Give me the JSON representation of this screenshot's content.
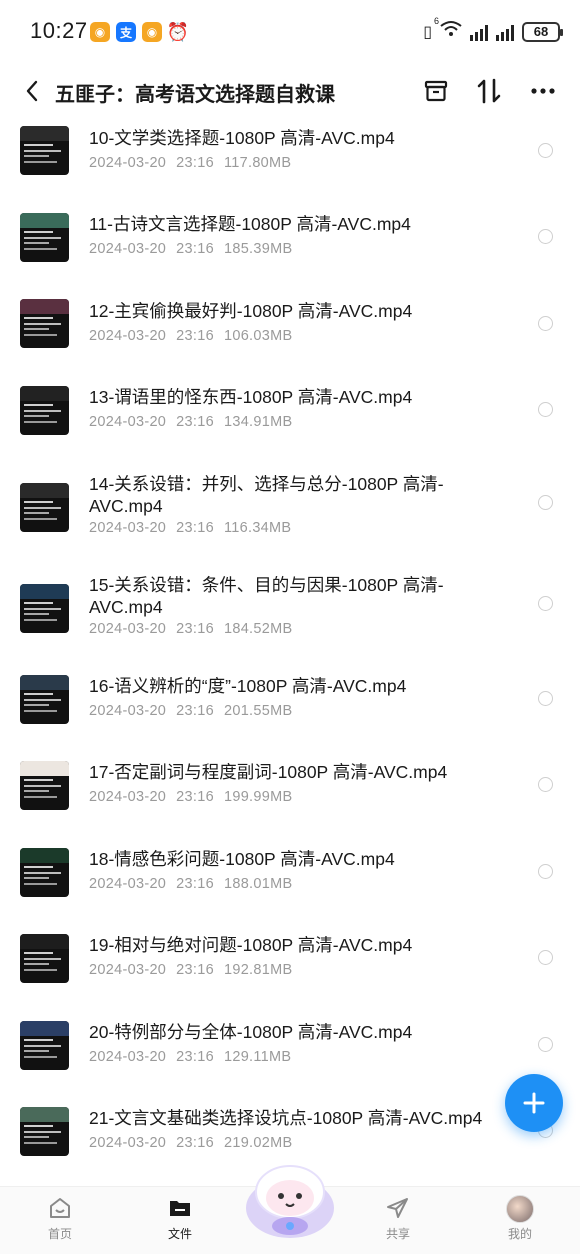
{
  "status_bar": {
    "time": "10:27",
    "battery": "68",
    "network_label": "6"
  },
  "header": {
    "title": "五匪子：高考语文选择题自救课"
  },
  "files": [
    {
      "name": "10-文学类选择题-1080P 高清-AVC.mp4",
      "date": "2024-03-20",
      "time": "23:16",
      "size": "117.80MB"
    },
    {
      "name": "11-古诗文言选择题-1080P 高清-AVC.mp4",
      "date": "2024-03-20",
      "time": "23:16",
      "size": "185.39MB"
    },
    {
      "name": "12-主宾偷换最好判-1080P 高清-AVC.mp4",
      "date": "2024-03-20",
      "time": "23:16",
      "size": "106.03MB"
    },
    {
      "name": "13-谓语里的怪东西-1080P 高清-AVC.mp4",
      "date": "2024-03-20",
      "time": "23:16",
      "size": "134.91MB"
    },
    {
      "name": "14-关系设错：并列、选择与总分-1080P 高清-AVC.mp4",
      "date": "2024-03-20",
      "time": "23:16",
      "size": "116.34MB"
    },
    {
      "name": "15-关系设错：条件、目的与因果-1080P 高清-AVC.mp4",
      "date": "2024-03-20",
      "time": "23:16",
      "size": "184.52MB"
    },
    {
      "name": "16-语义辨析的“度”-1080P 高清-AVC.mp4",
      "date": "2024-03-20",
      "time": "23:16",
      "size": "201.55MB"
    },
    {
      "name": "17-否定副词与程度副词-1080P 高清-AVC.mp4",
      "date": "2024-03-20",
      "time": "23:16",
      "size": "199.99MB"
    },
    {
      "name": "18-情感色彩问题-1080P 高清-AVC.mp4",
      "date": "2024-03-20",
      "time": "23:16",
      "size": "188.01MB"
    },
    {
      "name": "19-相对与绝对问题-1080P 高清-AVC.mp4",
      "date": "2024-03-20",
      "time": "23:16",
      "size": "192.81MB"
    },
    {
      "name": "20-特例部分与全体-1080P 高清-AVC.mp4",
      "date": "2024-03-20",
      "time": "23:16",
      "size": "129.11MB"
    },
    {
      "name": "21-文言文基础类选择设坑点-1080P 高清-AVC.mp4",
      "date": "2024-03-20",
      "time": "23:16",
      "size": "219.02MB"
    }
  ],
  "bottom_nav": {
    "home": "首页",
    "files": "文件",
    "share": "共享",
    "mine": "我的"
  },
  "colors": {
    "accent": "#1e90f5",
    "meta_text": "#9a9a9a"
  }
}
